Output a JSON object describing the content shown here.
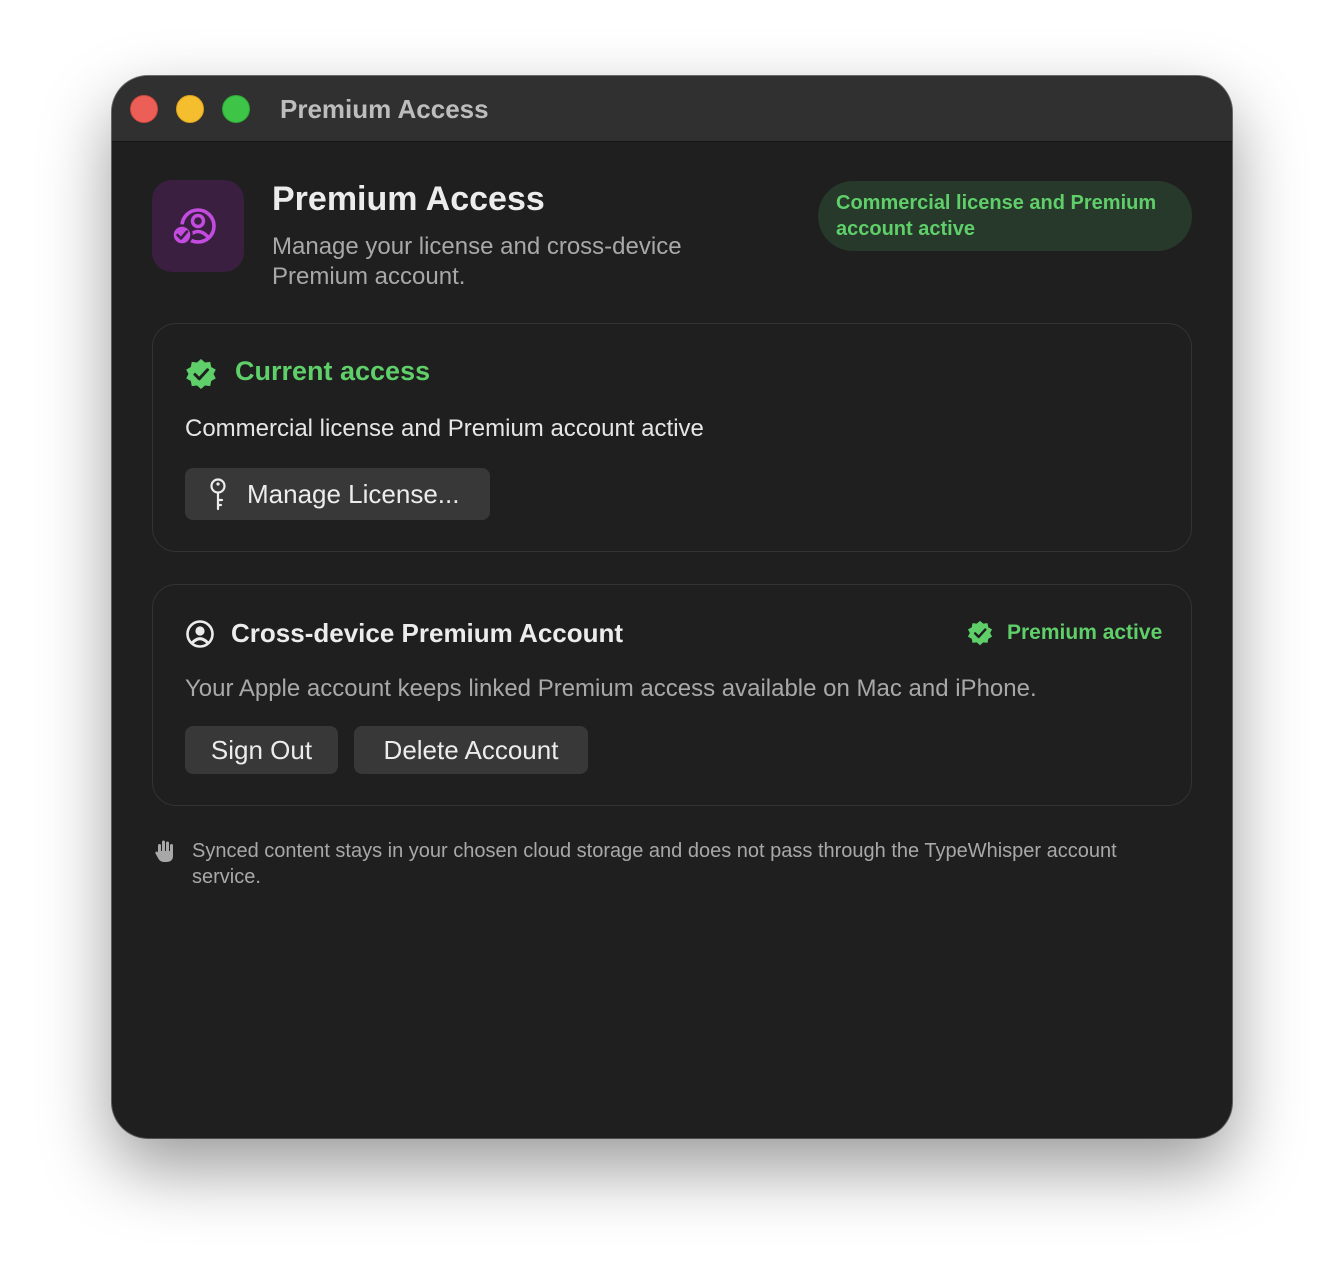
{
  "window": {
    "title": "Premium Access"
  },
  "header": {
    "icon": "person-badge-check-icon",
    "title": "Premium Access",
    "subtitle": "Manage your license and cross-device Premium account.",
    "status_pill": "Commercial license and Premium account active"
  },
  "current_access": {
    "icon": "checkmark-seal-icon",
    "title": "Current access",
    "description": "Commercial license and Premium account active",
    "manage_button": {
      "icon": "key-icon",
      "label": "Manage License..."
    }
  },
  "account": {
    "icon": "person-circle-icon",
    "title": "Cross-device Premium Account",
    "status": {
      "icon": "checkmark-seal-icon",
      "label": "Premium active"
    },
    "description": "Your Apple account keeps linked Premium access available on Mac and iPhone.",
    "buttons": {
      "sign_out": "Sign Out",
      "delete": "Delete Account"
    }
  },
  "footer": {
    "icon": "hand-raised-icon",
    "text": "Synced content stays in your chosen cloud storage and does not pass through the TypeWhisper account service."
  },
  "colors": {
    "accent_green": "#5fcf6a",
    "app_icon_bg": "#3a1f40",
    "app_icon_fg": "#c34be0",
    "window_bg": "#1f1f1f"
  }
}
